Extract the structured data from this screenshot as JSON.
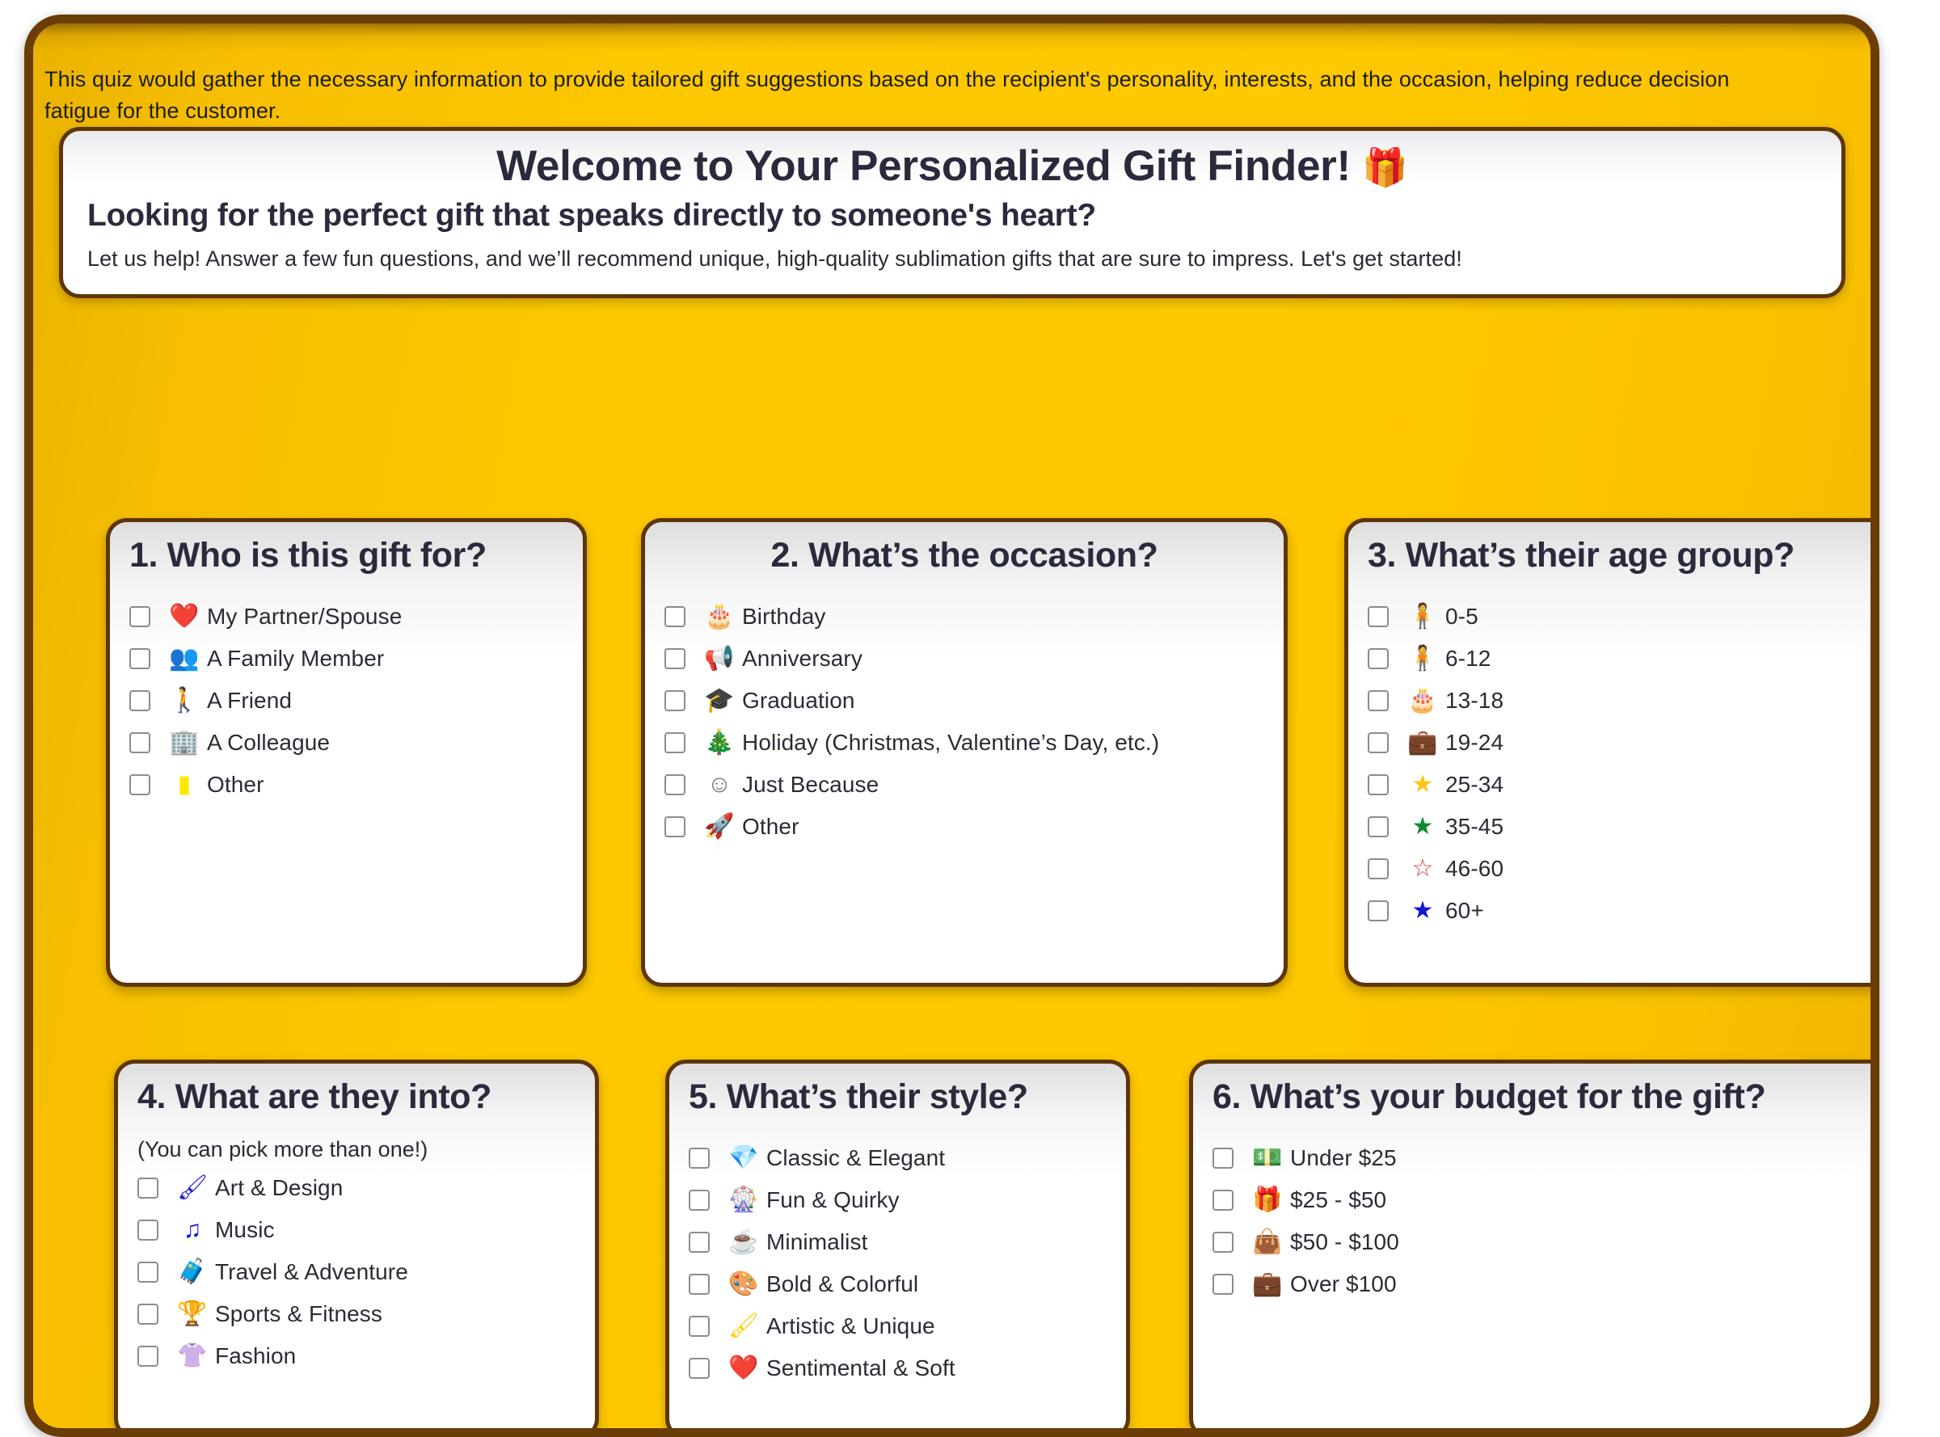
{
  "intro": {
    "text": "This quiz would gather the necessary information to provide tailored gift suggestions based on the recipient's personality, interests, and the occasion, helping reduce decision fatigue for the customer."
  },
  "welcome": {
    "title": "Welcome to Your Personalized Gift Finder!",
    "gift_icon": "🎁",
    "subtitle": "Looking for the perfect gift that speaks directly to someone's heart?",
    "body": "Let us help! Answer a few fun questions, and we’ll recommend unique, high-quality sublimation gifts that are sure to impress. Let's get started!"
  },
  "colors": {
    "panel_gold": "#FDC800",
    "panel_border_brown": "#6B3D06",
    "card_border_brown": "#5E3506",
    "heading_navy": "#292B3D",
    "gift_green": "#7EE08A"
  },
  "questions": [
    {
      "id": "q1",
      "title": "1. Who is this gift for?",
      "note": "",
      "options": [
        {
          "emoji": "❤️",
          "icon_name": "heart-icon",
          "label": "My Partner/Spouse",
          "color": "#e8232a"
        },
        {
          "emoji": "👥",
          "icon_name": "people-group-icon",
          "label": "A Family Member",
          "color": "#1f9e26"
        },
        {
          "emoji": "🚶",
          "icon_name": "person-standing-icon",
          "label": "A Friend",
          "color": "#2222cc"
        },
        {
          "emoji": "🏢",
          "icon_name": "office-building-icon",
          "label": "A Colleague",
          "color": "#8b2f8b"
        },
        {
          "emoji": "▮",
          "icon_name": "yellow-block-icon",
          "label": "Other",
          "color": "#ffe800"
        }
      ]
    },
    {
      "id": "q2",
      "title": "2. What’s the occasion?",
      "note": "",
      "options": [
        {
          "emoji": "🎂",
          "icon_name": "birthday-cake-icon",
          "label": "Birthday",
          "color": "#f59a0b"
        },
        {
          "emoji": "📢",
          "icon_name": "megaphone-icon",
          "label": "Anniversary",
          "color": "#f2c11b"
        },
        {
          "emoji": "🎓",
          "icon_name": "graduation-cap-icon",
          "label": "Graduation",
          "color": "#1a1a1a"
        },
        {
          "emoji": "🎄",
          "icon_name": "christmas-tree-icon",
          "label": "Holiday (Christmas, Valentine’s Day, etc.)",
          "color": "#157a20"
        },
        {
          "emoji": "☺",
          "icon_name": "smiley-face-icon",
          "label": "Just Because",
          "color": "#6e6e76"
        },
        {
          "emoji": "🚀",
          "icon_name": "rocket-icon",
          "label": "Other",
          "color": "#8fcbe8"
        }
      ]
    },
    {
      "id": "q3",
      "title": "3. What’s their age group?",
      "note": "",
      "options": [
        {
          "emoji": "🧍",
          "icon_name": "child-figure-icon",
          "label": "0-5",
          "color": "#a6d7ef"
        },
        {
          "emoji": "🧍",
          "icon_name": "person-figure-icon",
          "label": "6-12",
          "color": "#15154a"
        },
        {
          "emoji": "🎂",
          "icon_name": "birthday-cake-red-icon",
          "label": "13-18",
          "color": "#e32222"
        },
        {
          "emoji": "💼",
          "icon_name": "briefcase-icon",
          "label": "19-24",
          "color": "#9b2222"
        },
        {
          "emoji": "★",
          "icon_name": "star-gold-icon",
          "label": "25-34",
          "color": "#fcc419"
        },
        {
          "emoji": "★",
          "icon_name": "star-green-icon",
          "label": "35-45",
          "color": "#138a2e"
        },
        {
          "emoji": "☆",
          "icon_name": "star-outline-red-icon",
          "label": "46-60",
          "color": "#e23b3b"
        },
        {
          "emoji": "★",
          "icon_name": "star-blue-icon",
          "label": "60+",
          "color": "#1616d6"
        }
      ]
    },
    {
      "id": "q4",
      "title": "4. What are they into?",
      "note": "(You can pick more than one!)",
      "options": [
        {
          "emoji": "🖌",
          "icon_name": "paintbrush-blue-icon",
          "label": "Art & Design",
          "color": "#1a1ae0"
        },
        {
          "emoji": "♫",
          "icon_name": "music-note-icon",
          "label": "Music",
          "color": "#1a1ae0"
        },
        {
          "emoji": "🧳",
          "icon_name": "suitcase-icon",
          "label": "Travel & Adventure",
          "color": "#9b2222"
        },
        {
          "emoji": "🏆",
          "icon_name": "trophy-icon",
          "label": "Sports & Fitness",
          "color": "#169c3b"
        },
        {
          "emoji": "👚",
          "icon_name": "clothing-icon",
          "label": "Fashion",
          "color": "#f08a1e"
        }
      ]
    },
    {
      "id": "q5",
      "title": "5. What’s their style?",
      "note": "",
      "options": [
        {
          "emoji": "💎",
          "icon_name": "gem-icon",
          "label": "Classic & Elegant",
          "color": "#b23bb2"
        },
        {
          "emoji": "🎡",
          "icon_name": "fun-frame-icon",
          "label": "Fun & Quirky",
          "color": "#127a2c"
        },
        {
          "emoji": "☕",
          "icon_name": "coffee-cup-icon",
          "label": "Minimalist",
          "color": "#8fb8d6"
        },
        {
          "emoji": "🎨",
          "icon_name": "bold-frame-icon",
          "label": "Bold & Colorful",
          "color": "#ef2b4a"
        },
        {
          "emoji": "🖌",
          "icon_name": "paintbrush-yellow-icon",
          "label": "Artistic & Unique",
          "color": "#ffd000"
        },
        {
          "emoji": "❤️",
          "icon_name": "heart-blue-icon",
          "label": "Sentimental & Soft",
          "color": "#1616d6"
        }
      ]
    },
    {
      "id": "q6",
      "title": "6. What’s your budget for the gift?",
      "note": "",
      "options": [
        {
          "emoji": "💵",
          "icon_name": "banknote-icon",
          "label": "Under $25",
          "color": "#157a20"
        },
        {
          "emoji": "🎁",
          "icon_name": "gift-red-icon",
          "label": "$25 - $50",
          "color": "#e32222"
        },
        {
          "emoji": "👜",
          "icon_name": "handbag-icon",
          "label": "$50 - $100",
          "color": "#1616d6"
        },
        {
          "emoji": "💼",
          "icon_name": "briefcase-icon",
          "label": "Over $100",
          "color": "#9b2222"
        }
      ]
    }
  ]
}
